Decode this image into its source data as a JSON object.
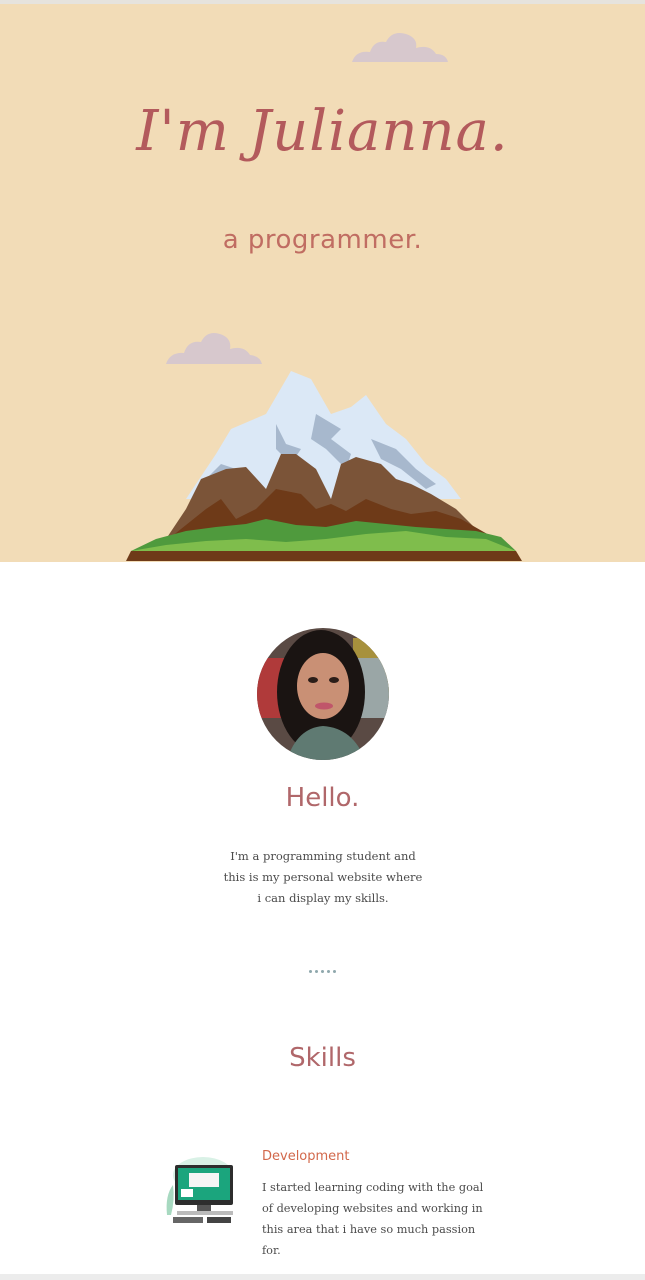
{
  "hero": {
    "title": "I'm Julianna.",
    "subtitle": "a programmer."
  },
  "about": {
    "heading": "Hello.",
    "text": "I'm a programming student and this is my personal website where i can display my skills."
  },
  "skills": {
    "heading": "Skills",
    "items": [
      {
        "name": "Development",
        "description": "I started learning coding with the goal of developing websites and working in this area that i have so much passion for.",
        "icon": "computer-icon"
      }
    ]
  },
  "colors": {
    "hero_background": "#f2dcb7",
    "title_color": "#b35a5c",
    "heading_color": "#b0676a",
    "skill_name_color": "#d2684b"
  }
}
